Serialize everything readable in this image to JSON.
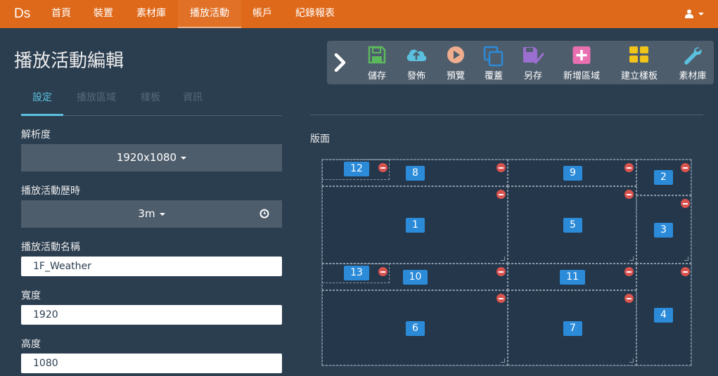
{
  "navbar": {
    "brand": "Ds",
    "items": [
      {
        "label": "首頁",
        "active": false
      },
      {
        "label": "裝置",
        "active": false
      },
      {
        "label": "素材庫",
        "active": false
      },
      {
        "label": "播放活動",
        "active": true
      },
      {
        "label": "帳戶",
        "active": false
      },
      {
        "label": "紀錄報表",
        "active": false
      }
    ],
    "user_icon": "user-icon"
  },
  "page": {
    "title": "播放活動編輯"
  },
  "tabs": [
    {
      "label": "設定",
      "active": true
    },
    {
      "label": "播放區域",
      "active": false
    },
    {
      "label": "樣板",
      "active": false
    },
    {
      "label": "資訊",
      "active": false
    }
  ],
  "form": {
    "resolution": {
      "label": "解析度",
      "value": "1920x1080"
    },
    "duration": {
      "label": "播放活動歷時",
      "value": "3m"
    },
    "name": {
      "label": "播放活動名稱",
      "value": "1F_Weather"
    },
    "width": {
      "label": "寬度",
      "value": "1920"
    },
    "height": {
      "label": "高度",
      "value": "1080"
    }
  },
  "toolbar": {
    "collapse_icon": "chevron-right-icon",
    "buttons": [
      {
        "label": "儲存",
        "icon": "save-icon",
        "color": "#5cb85c"
      },
      {
        "label": "發佈",
        "icon": "cloud-upload-icon",
        "color": "#5bc0de"
      },
      {
        "label": "預覽",
        "icon": "play-icon",
        "color": "#f0ad8e"
      },
      {
        "label": "覆蓋",
        "icon": "copy-icon",
        "color": "#2b8bd9"
      },
      {
        "label": "另存",
        "icon": "save-as-icon",
        "color": "#9b6fcf"
      },
      {
        "label": "新增區域",
        "icon": "plus-square-icon",
        "color": "#e86fb0"
      },
      {
        "label": "建立樣板",
        "icon": "grid-icon",
        "color": "#f0c419"
      },
      {
        "label": "素材庫",
        "icon": "wrench-icon",
        "color": "#5bc0de"
      }
    ]
  },
  "canvas": {
    "label": "版面",
    "regions": [
      {
        "id": "12"
      },
      {
        "id": "8"
      },
      {
        "id": "9"
      },
      {
        "id": "2"
      },
      {
        "id": "1"
      },
      {
        "id": "5"
      },
      {
        "id": "3"
      },
      {
        "id": "13"
      },
      {
        "id": "10"
      },
      {
        "id": "11"
      },
      {
        "id": "4"
      },
      {
        "id": "6"
      },
      {
        "id": "7"
      }
    ]
  },
  "colors": {
    "navbar": "#df691a",
    "background": "#2b3e50",
    "accent": "#5bc0de",
    "badge": "#2b8bd9",
    "remove": "#d9534f"
  }
}
